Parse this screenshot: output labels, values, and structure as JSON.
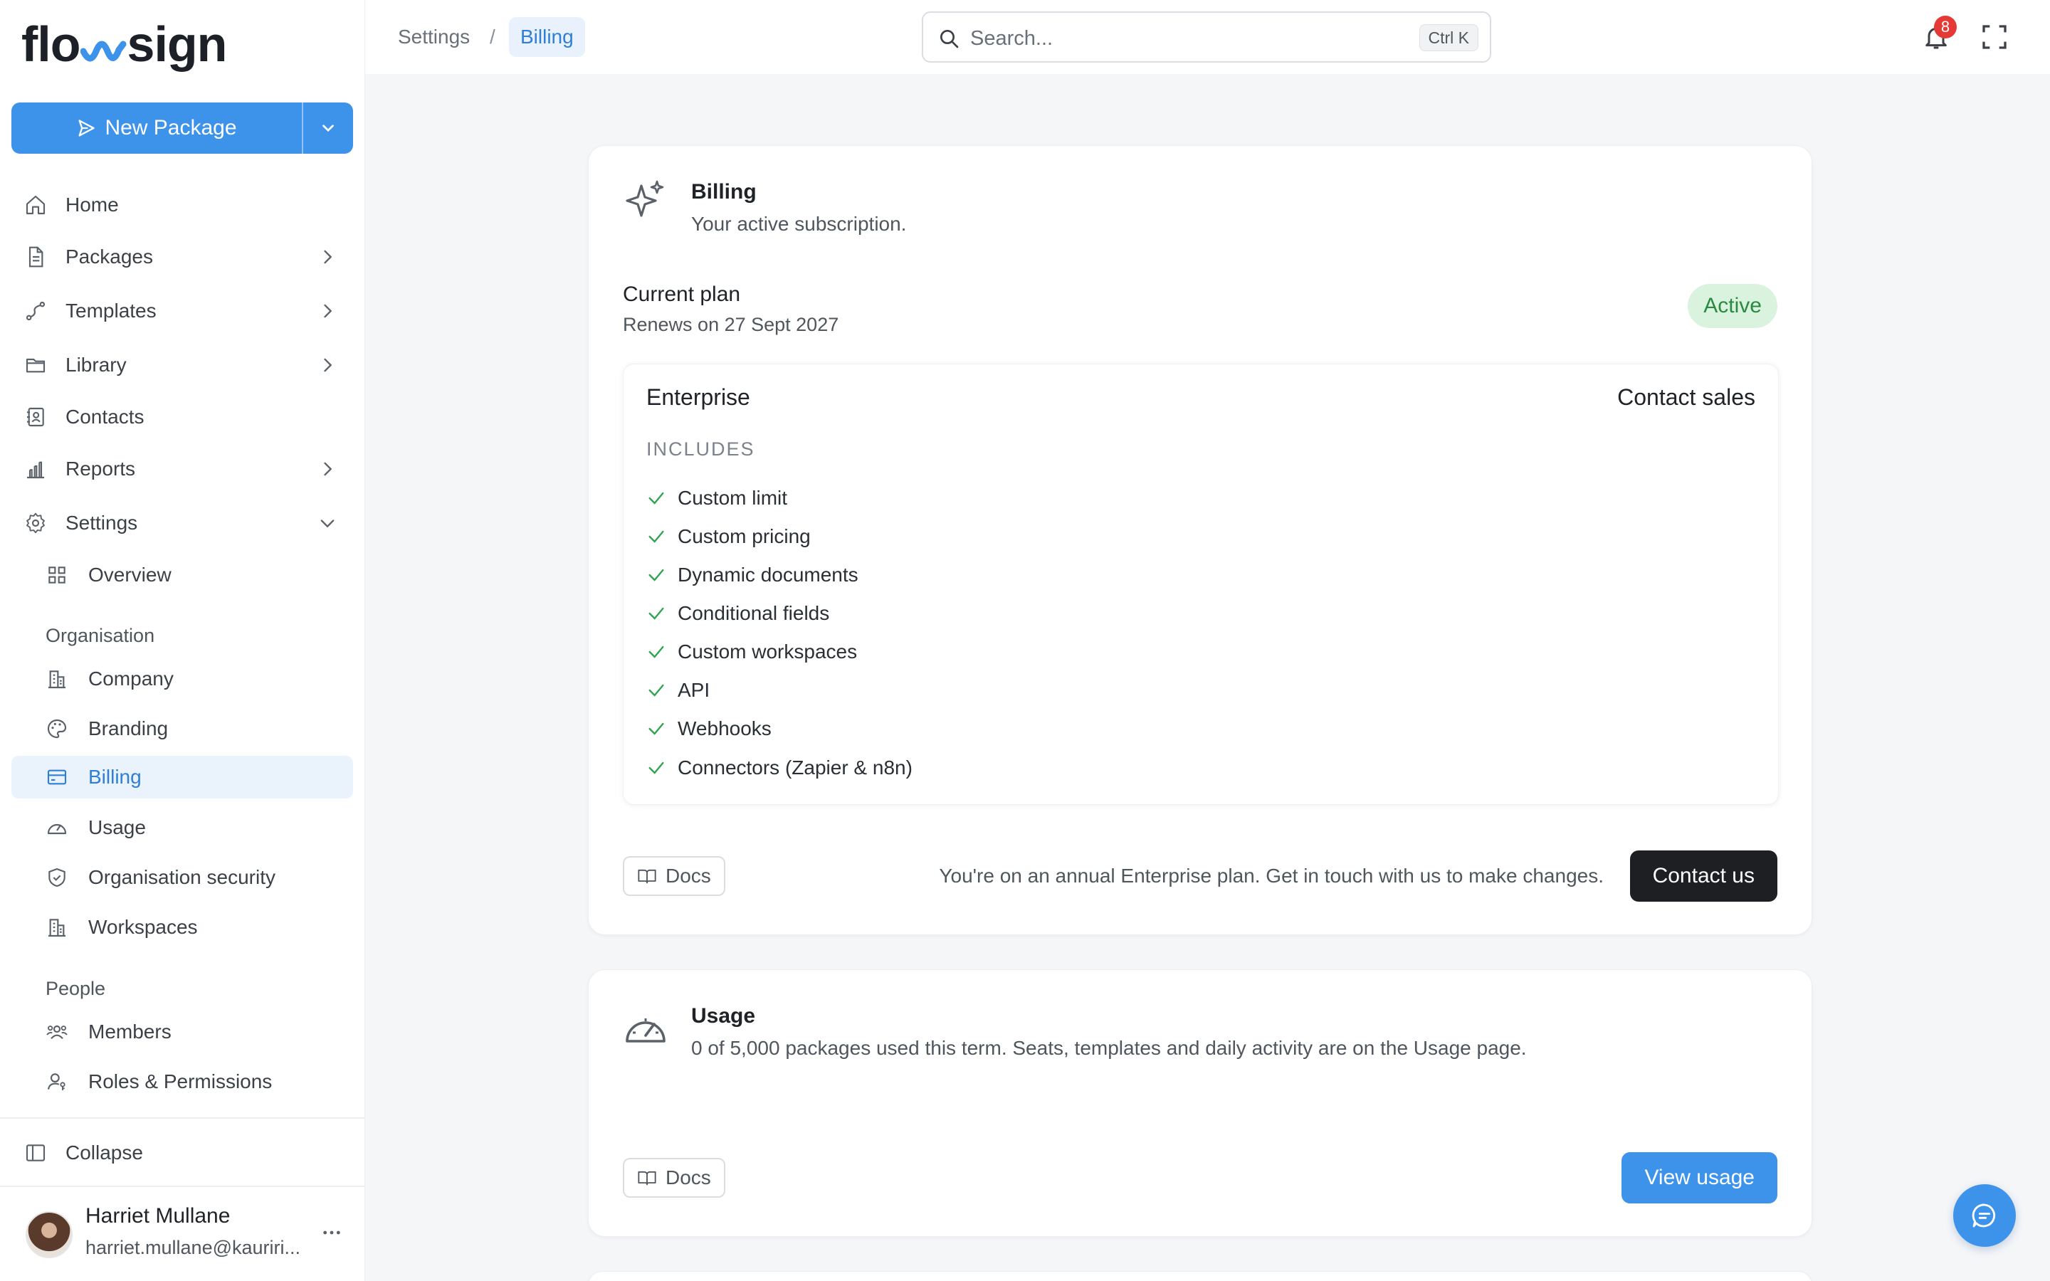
{
  "brand": {
    "name": "flowsign",
    "accent": "#3d93ea"
  },
  "sidebar": {
    "new_package_label": "New Package",
    "items": [
      {
        "label": "Home",
        "icon": "home-icon"
      },
      {
        "label": "Packages",
        "icon": "file-icon"
      },
      {
        "label": "Templates",
        "icon": "route-icon"
      },
      {
        "label": "Library",
        "icon": "folder-icon"
      },
      {
        "label": "Contacts",
        "icon": "contact-book-icon"
      },
      {
        "label": "Reports",
        "icon": "bar-chart-icon"
      },
      {
        "label": "Settings",
        "icon": "gear-icon"
      }
    ],
    "settings_children": {
      "overview": "Overview"
    },
    "organisation": {
      "heading": "Organisation",
      "items": [
        "Company",
        "Branding",
        "Billing",
        "Usage",
        "Organisation security",
        "Workspaces"
      ]
    },
    "people": {
      "heading": "People",
      "items": [
        "Members",
        "Roles & Permissions"
      ]
    },
    "collapse_label": "Collapse",
    "user": {
      "name": "Harriet Mullane",
      "email": "harriet.mullane@kauriri..."
    }
  },
  "topbar": {
    "breadcrumb": [
      "Settings",
      "/",
      "Billing"
    ],
    "search_placeholder": "Search...",
    "search_shortcut": "Ctrl K",
    "notification_count": "8"
  },
  "billing": {
    "title": "Billing",
    "subtitle": "Your active subscription.",
    "current_plan_label": "Current plan",
    "renews": "Renews on 27 Sept 2027",
    "status": "Active",
    "plan": {
      "name": "Enterprise",
      "price_label": "Contact sales",
      "includes_label": "INCLUDES",
      "features": [
        "Custom limit",
        "Custom pricing",
        "Dynamic documents",
        "Conditional fields",
        "Custom workspaces",
        "API",
        "Webhooks",
        "Connectors (Zapier & n8n)"
      ]
    },
    "docs_label": "Docs",
    "note": "You're on an annual Enterprise plan. Get in touch with us to make changes.",
    "contact_label": "Contact us"
  },
  "usage": {
    "title": "Usage",
    "subtitle": "0 of 5,000 packages used this term. Seats, templates and daily activity are on the Usage page.",
    "docs_label": "Docs",
    "view_label": "View usage"
  }
}
